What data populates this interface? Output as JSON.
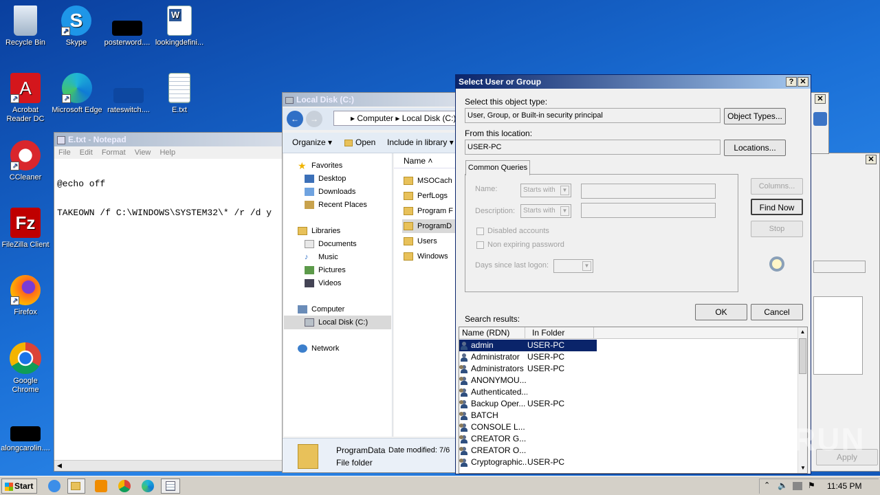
{
  "desktop_icons": [
    {
      "label": "Recycle Bin",
      "icon": "recycle-bin-icon"
    },
    {
      "label": "Skype",
      "icon": "skype-icon"
    },
    {
      "label": "posterword....",
      "icon": "blank-file-icon"
    },
    {
      "label": "lookingdefini...",
      "icon": "word-document-icon"
    },
    {
      "label": "Acrobat Reader DC",
      "icon": "acrobat-icon"
    },
    {
      "label": "Microsoft Edge",
      "icon": "edge-icon"
    },
    {
      "label": "rateswitch....",
      "icon": "blank-file-icon"
    },
    {
      "label": "E.txt",
      "icon": "text-file-icon"
    },
    {
      "label": "CCleaner",
      "icon": "ccleaner-icon"
    },
    {
      "label": "FileZilla Client",
      "icon": "filezilla-icon"
    },
    {
      "label": "Firefox",
      "icon": "firefox-icon"
    },
    {
      "label": "Google Chrome",
      "icon": "chrome-icon"
    },
    {
      "label": "alongcarolin....",
      "icon": "blank-file-icon"
    }
  ],
  "notepad": {
    "title": "E.txt - Notepad",
    "menu": [
      "File",
      "Edit",
      "Format",
      "View",
      "Help"
    ],
    "lines": [
      "@echo off",
      "TAKEOWN /f C:\\WINDOWS\\SYSTEM32\\* /r /d y"
    ]
  },
  "explorer": {
    "title": "Local Disk (C:)",
    "breadcrumb": [
      "Computer",
      "Local Disk (C:)"
    ],
    "toolbar": [
      "Organize",
      "Open",
      "Include in library"
    ],
    "column_name": "Name",
    "nav": {
      "favorites": "Favorites",
      "favorites_items": [
        "Desktop",
        "Downloads",
        "Recent Places"
      ],
      "libraries": "Libraries",
      "libraries_items": [
        "Documents",
        "Music",
        "Pictures",
        "Videos"
      ],
      "computer": "Computer",
      "computer_items": [
        "Local Disk (C:)"
      ],
      "network": "Network"
    },
    "files": [
      "MSOCach",
      "PerfLogs",
      "Program F",
      "ProgramD",
      "Users",
      "Windows"
    ],
    "details": {
      "name": "ProgramData",
      "modified": "Date modified: 7/6",
      "type": "File folder"
    }
  },
  "dialog": {
    "title": "Select User or Group",
    "object_type_label": "Select this object type:",
    "object_type_value": "User, Group, or Built-in security principal",
    "object_types_btn": "Object Types...",
    "location_label": "From this location:",
    "location_value": "USER-PC",
    "locations_btn": "Locations...",
    "tab": "Common Queries",
    "name_label": "Name:",
    "desc_label": "Description:",
    "starts_with": "Starts with",
    "disabled_accounts": "Disabled accounts",
    "non_expiring": "Non expiring password",
    "days_label": "Days since last logon:",
    "columns_btn": "Columns...",
    "find_now_btn": "Find Now",
    "stop_btn": "Stop",
    "ok_btn": "OK",
    "cancel_btn": "Cancel",
    "results_label": "Search results:",
    "col_name": "Name (RDN)",
    "col_folder": "In Folder",
    "results": [
      {
        "name": "admin",
        "folder": "USER-PC",
        "kind": "user"
      },
      {
        "name": "Administrator",
        "folder": "USER-PC",
        "kind": "user"
      },
      {
        "name": "Administrators",
        "folder": "USER-PC",
        "kind": "group"
      },
      {
        "name": "ANONYMOU...",
        "folder": "",
        "kind": "group"
      },
      {
        "name": "Authenticated...",
        "folder": "",
        "kind": "group"
      },
      {
        "name": "Backup Oper...",
        "folder": "USER-PC",
        "kind": "group"
      },
      {
        "name": "BATCH",
        "folder": "",
        "kind": "group"
      },
      {
        "name": "CONSOLE L...",
        "folder": "",
        "kind": "group"
      },
      {
        "name": "CREATOR G...",
        "folder": "",
        "kind": "group"
      },
      {
        "name": "CREATOR O...",
        "folder": "",
        "kind": "group"
      },
      {
        "name": "Cryptographic...",
        "folder": "USER-PC",
        "kind": "group"
      }
    ]
  },
  "bg_dialog": {
    "apply_btn": "Apply"
  },
  "watermark": "ANY RUN",
  "taskbar": {
    "start": "Start",
    "time": "11:45 PM"
  },
  "colors": {
    "selection": "#0a246a",
    "title_active": "#0a246a",
    "desktop": "#1a6fd6"
  }
}
